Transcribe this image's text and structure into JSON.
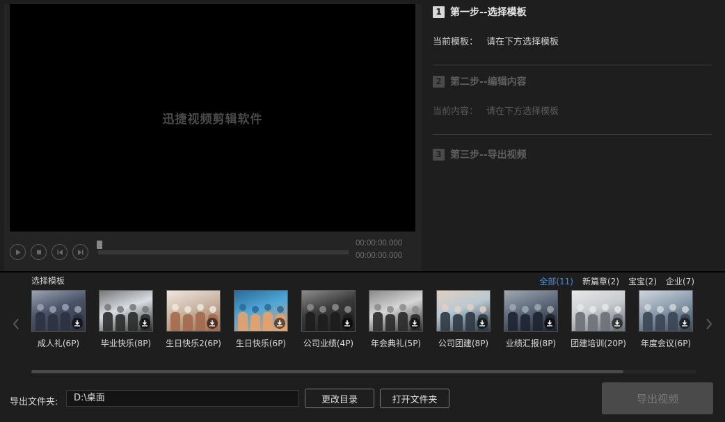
{
  "player": {
    "watermark": "迅捷视频剪辑软件",
    "time_current": "00:00:00.000",
    "time_total": "00:00:00.000",
    "progress": 0
  },
  "steps": [
    {
      "num": "1",
      "label": "第一步--选择模板",
      "info_key": "当前模板：",
      "info_value": "请在下方选择模板",
      "active": true
    },
    {
      "num": "2",
      "label": "第二步--编辑内容",
      "info_key": "当前内容：",
      "info_value": "请在下方选择模板",
      "active": false
    },
    {
      "num": "3",
      "label": "第三步--导出视频",
      "active": false
    }
  ],
  "templates": {
    "heading": "选择模板",
    "filters": [
      {
        "label": "全部(11)",
        "active": true
      },
      {
        "label": "新篇章(2)",
        "active": false
      },
      {
        "label": "宝宝(2)",
        "active": false
      },
      {
        "label": "企业(7)",
        "active": false
      }
    ],
    "items": [
      {
        "label": "成人礼(6P)",
        "colors": [
          "#4a5468",
          "#2c3240",
          "#9aa3b2"
        ]
      },
      {
        "label": "毕业快乐(8P)",
        "colors": [
          "#d9dde2",
          "#2b2b2b",
          "#777"
        ]
      },
      {
        "label": "生日快乐2(6P)",
        "colors": [
          "#c9b7a6",
          "#a36a4c",
          "#efe7dd"
        ]
      },
      {
        "label": "生日快乐(6P)",
        "colors": [
          "#4fa7d8",
          "#e6a26b",
          "#2b6a96"
        ]
      },
      {
        "label": "公司业绩(4P)",
        "colors": [
          "#3a3a3a",
          "#1d1d1d",
          "#8c8c8c"
        ]
      },
      {
        "label": "年会典礼(5P)",
        "colors": [
          "#d6d6d6",
          "#2a2a2a",
          "#8a8a8a"
        ]
      },
      {
        "label": "公司团建(8P)",
        "colors": [
          "#b8c8d2",
          "#2d3a44",
          "#e2d0c2"
        ]
      },
      {
        "label": "业绩汇报(8P)",
        "colors": [
          "#5f6c7c",
          "#1e2430",
          "#a0a8b0"
        ]
      },
      {
        "label": "团建培训(20P)",
        "colors": [
          "#c9ccd0",
          "#6d7078",
          "#e8e8e8"
        ]
      },
      {
        "label": "年度会议(6P)",
        "colors": [
          "#8d9eae",
          "#3a4654",
          "#cfd6dc"
        ]
      }
    ]
  },
  "export": {
    "label": "导出文件夹:",
    "path": "D:\\桌面",
    "change_dir": "更改目录",
    "open_folder": "打开文件夹",
    "export_btn": "导出视频"
  },
  "icons": {
    "play": "play-icon",
    "stop": "stop-icon",
    "prev": "previous-frame-icon",
    "next": "next-frame-icon",
    "download": "download-icon",
    "left": "chevron-left-icon",
    "right": "chevron-right-icon"
  }
}
